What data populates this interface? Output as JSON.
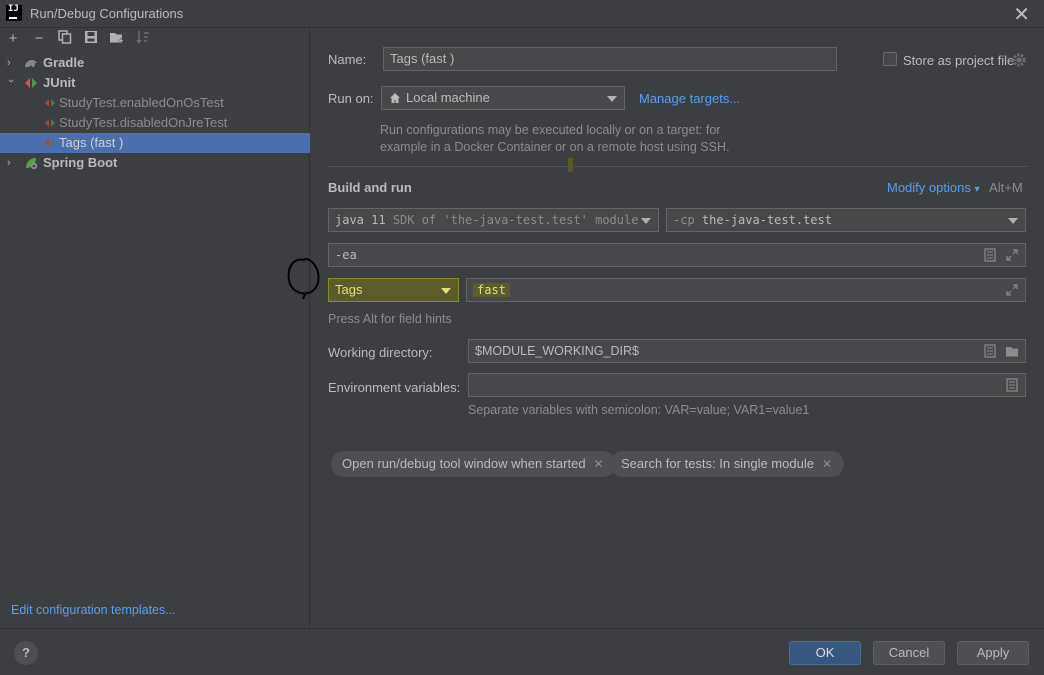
{
  "window": {
    "title": "Run/Debug Configurations",
    "app_icon": "IJ"
  },
  "toolbar": {
    "icons": [
      "add-icon",
      "remove-icon",
      "copy-icon",
      "save-icon",
      "new-folder-icon",
      "sort-icon"
    ]
  },
  "tree": {
    "gradle": "Gradle",
    "junit": "JUnit",
    "item1": "StudyTest.enabledOnOsTest",
    "item2": "StudyTest.disabledOnJreTest",
    "item3": "Tags (fast )",
    "spring": "Spring Boot"
  },
  "left_footer": {
    "templates_link": "Edit configuration templates..."
  },
  "form": {
    "name_label": "Name:",
    "name_value": "Tags (fast )",
    "store_label": "Store as project file",
    "run_on_label": "Run on:",
    "run_on_value": "Local machine",
    "manage_targets": "Manage targets...",
    "run_info_1": "Run configurations may be executed locally or on a target: for",
    "run_info_2": "example in a Docker Container or on a remote host using SSH.",
    "build_title": "Build and run",
    "modify_options": "Modify options",
    "modify_shortcut": "Alt+M",
    "jdk_java": "java 11",
    "jdk_detail": "SDK of 'the-java-test.test' module",
    "cp_prefix": "-cp",
    "cp_value": "the-java-test.test",
    "vm_options": "-ea",
    "test_kind": "Tags",
    "tag_value": "fast",
    "field_hint": "Press Alt for field hints",
    "workdir_label": "Working directory:",
    "workdir_value": "$MODULE_WORKING_DIR$",
    "env_label": "Environment variables:",
    "env_value": "",
    "env_hint": "Separate variables with semicolon: VAR=value; VAR1=value1"
  },
  "chips": [
    {
      "label": "Open run/debug tool window when started"
    },
    {
      "label": "Search for tests: In single module"
    }
  ],
  "buttons": {
    "help": "?",
    "ok": "OK",
    "cancel": "Cancel",
    "apply": "Apply"
  },
  "colors": {
    "accent": "#4b6eaf",
    "link": "#589df6",
    "highlight": "#c6c600"
  }
}
